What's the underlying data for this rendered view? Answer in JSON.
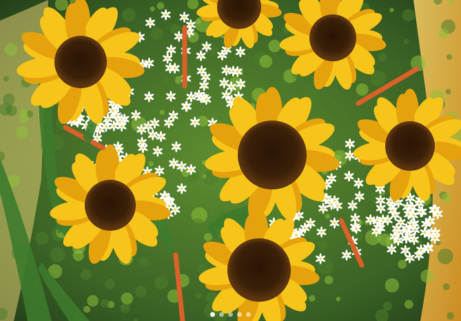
{
  "image": {
    "subject": "sunflower-bouquet",
    "colors": {
      "petal": "#f7c51a",
      "petal_shade": "#e6a20c",
      "center": "#3a2008",
      "center_ring": "#5b3510",
      "foliage": "#4d7d2a",
      "foliage_light": "#8fbf3a",
      "daisy": "#ffffff",
      "wrap": "#f2b53a",
      "wheat": "#d9612a"
    }
  },
  "carousel": {
    "slide_count": 5,
    "active_index": 0
  }
}
